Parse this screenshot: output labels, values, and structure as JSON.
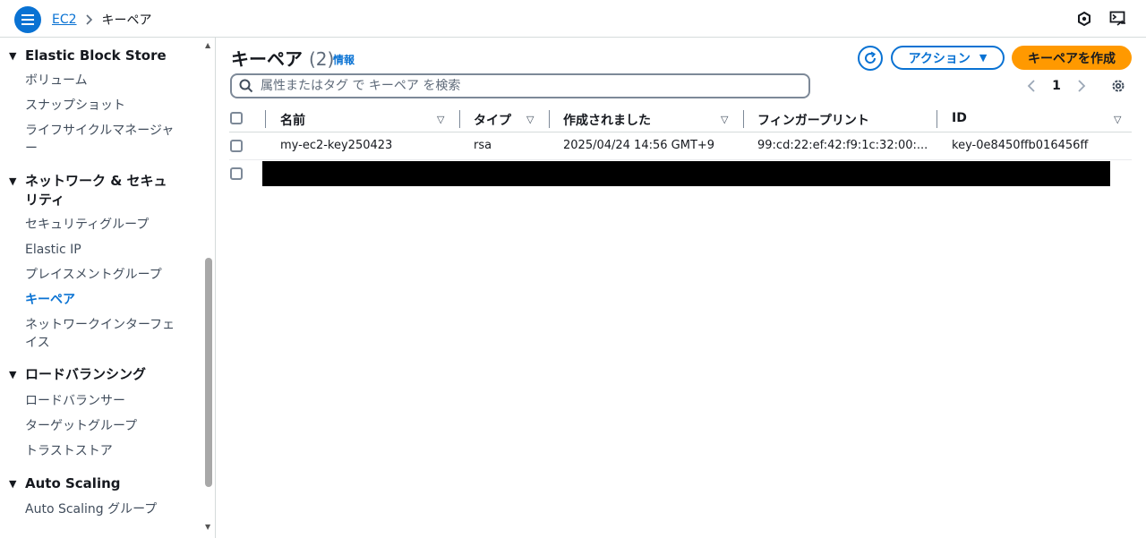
{
  "topbar": {
    "breadcrumb_link": "EC2",
    "breadcrumb_current": "キーペア"
  },
  "sidebar": {
    "sections": [
      {
        "title": "Elastic Block Store",
        "items": [
          "ボリューム",
          "スナップショット",
          "ライフサイクルマネージャー"
        ]
      },
      {
        "title": "ネットワーク & セキュリティ",
        "items": [
          "セキュリティグループ",
          "Elastic IP",
          "プレイスメントグループ",
          "キーペア",
          "ネットワークインターフェイス"
        ]
      },
      {
        "title": "ロードバランシング",
        "items": [
          "ロードバランサー",
          "ターゲットグループ",
          "トラストストア"
        ]
      },
      {
        "title": "Auto Scaling",
        "items": [
          "Auto Scaling グループ"
        ]
      }
    ],
    "active_item": "キーペア"
  },
  "main": {
    "title": "キーペア",
    "count": "(2)",
    "info_link": "情報",
    "actions_label": "アクション",
    "create_label": "キーペアを作成",
    "search_placeholder": "属性またはタグ で キーペア を検索",
    "page_number": "1",
    "table": {
      "columns": [
        "名前",
        "タイプ",
        "作成されました",
        "フィンガープリント",
        "ID"
      ],
      "rows": [
        {
          "name": "my-ec2-key250423",
          "type": "rsa",
          "created": "2025/04/24 14:56 GMT+9",
          "fingerprint": "99:cd:22:ef:42:f9:1c:32:00:...",
          "id": "key-0e8450ffb016456ff"
        }
      ]
    }
  },
  "colors": {
    "accent": "#0972d3",
    "primary_button": "#ff9900",
    "border": "#d5dbdb"
  },
  "icons": [
    "menu-icon",
    "chevron-right-icon",
    "notifications-icon",
    "cloudshell-icon",
    "refresh-icon",
    "caret-down-icon",
    "search-icon",
    "chevron-left-icon",
    "settings-icon",
    "sort-icon"
  ]
}
